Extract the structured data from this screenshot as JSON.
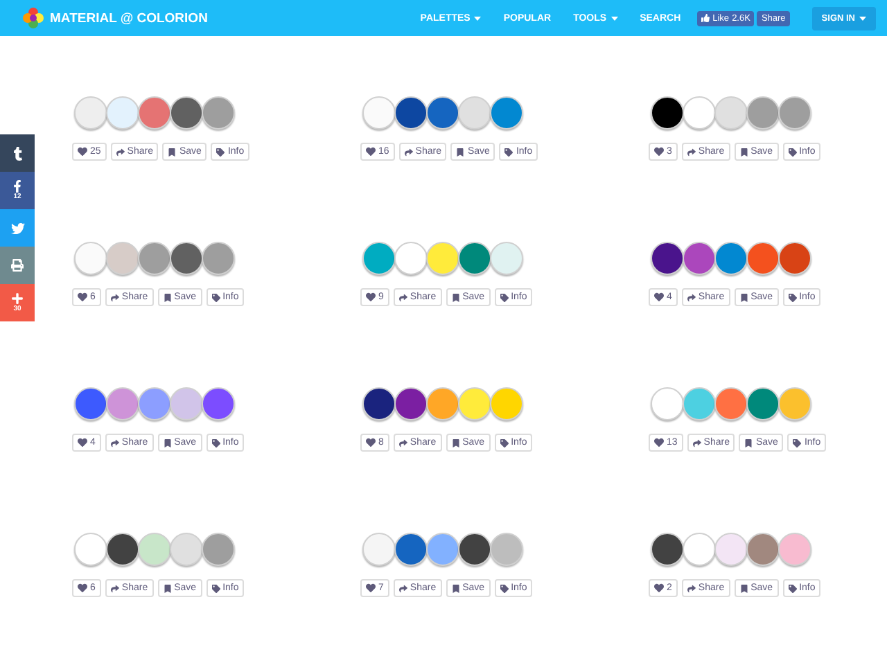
{
  "header": {
    "logo": "MATERIAL @ COLORION",
    "nav": [
      {
        "label": "PALETTES",
        "kind": "dropdown"
      },
      {
        "label": "POPULAR",
        "kind": "link"
      },
      {
        "label": "TOOLS",
        "kind": "dropdown"
      },
      {
        "label": "SEARCH",
        "kind": "link"
      }
    ],
    "like": {
      "label": "Like",
      "count": "2.6K"
    },
    "share": "Share",
    "sign_in": "SIGN IN"
  },
  "share_bar": [
    {
      "kind": "tumblr"
    },
    {
      "kind": "facebook",
      "count": "12"
    },
    {
      "kind": "twitter"
    },
    {
      "kind": "print"
    },
    {
      "kind": "add",
      "count": "30"
    }
  ],
  "palettes": [
    {
      "swatches": [
        {
          "color": "#eeeeee"
        },
        {
          "color": "#e3f2fd"
        },
        {
          "color": "#e57373"
        },
        {
          "color": "#616161"
        },
        {
          "color": "#9e9e9e"
        }
      ],
      "likes": "25",
      "actions": [
        "Share",
        "Save",
        "Info"
      ]
    },
    {
      "swatches": [
        {
          "color": "#fafafa"
        },
        {
          "color": "#0d47a1"
        },
        {
          "color": "#1565c0"
        },
        {
          "color": "#e0e0e0"
        },
        {
          "color": "#0288d1"
        }
      ],
      "likes": "16",
      "actions": [
        "Share",
        "Save",
        "Info"
      ]
    },
    {
      "swatches": [
        {
          "color": "#000000"
        },
        {
          "color": "#ffffff"
        },
        {
          "color": "#e0e0e0"
        },
        {
          "color": "#9e9e9e"
        },
        {
          "color": "#9e9e9e"
        }
      ],
      "likes": "3",
      "actions": [
        "Share",
        "Save",
        "Info"
      ]
    },
    {
      "swatches": [
        {
          "color": "#fafafa"
        },
        {
          "color": "#d7ccc8"
        },
        {
          "color": "#9e9e9e"
        },
        {
          "color": "#616161"
        },
        {
          "color": "#9e9e9e"
        }
      ],
      "likes": "6",
      "actions": [
        "Share",
        "Save",
        "Info"
      ]
    },
    {
      "swatches": [
        {
          "color": "#00acc1"
        },
        {
          "color": "#ffffff"
        },
        {
          "color": "#ffeb3b"
        },
        {
          "color": "#00897b"
        },
        {
          "color": "#e0f2f1"
        }
      ],
      "likes": "9",
      "actions": [
        "Share",
        "Save",
        "Info"
      ]
    },
    {
      "swatches": [
        {
          "color": "#4a148c"
        },
        {
          "color": "#ab47bc"
        },
        {
          "color": "#0288d1"
        },
        {
          "color": "#f4511e"
        },
        {
          "color": "#d84315"
        }
      ],
      "likes": "4",
      "actions": [
        "Share",
        "Save",
        "Info"
      ]
    },
    {
      "swatches": [
        {
          "color": "#3d5afe"
        },
        {
          "color": "#ce93d8"
        },
        {
          "color": "#8c9eff"
        },
        {
          "color": "#d1c4e9"
        },
        {
          "color": "#7c4dff"
        }
      ],
      "likes": "4",
      "actions": [
        "Share",
        "Save",
        "Info"
      ]
    },
    {
      "swatches": [
        {
          "color": "#1a237e"
        },
        {
          "color": "#7b1fa2"
        },
        {
          "color": "#ffa726"
        },
        {
          "color": "#ffeb3b"
        },
        {
          "color": "#ffd600"
        }
      ],
      "likes": "8",
      "actions": [
        "Share",
        "Save",
        "Info"
      ]
    },
    {
      "swatches": [
        {
          "color": "#ffffff"
        },
        {
          "color": "#4dd0e1"
        },
        {
          "color": "#ff7043"
        },
        {
          "color": "#00897b"
        },
        {
          "color": "#fbc02d"
        }
      ],
      "likes": "13",
      "actions": [
        "Share",
        "Save",
        "Info"
      ]
    },
    {
      "swatches": [
        {
          "color": "#ffffff"
        },
        {
          "color": "#424242"
        },
        {
          "color": "#c8e6c9"
        },
        {
          "color": "#e0e0e0"
        },
        {
          "color": "#9e9e9e"
        }
      ],
      "likes": "6",
      "actions": [
        "Share",
        "Save",
        "Info"
      ]
    },
    {
      "swatches": [
        {
          "color": "#f5f5f5"
        },
        {
          "color": "#1565c0"
        },
        {
          "color": "#82b1ff"
        },
        {
          "color": "#424242"
        },
        {
          "color": "#bdbdbd"
        }
      ],
      "likes": "7",
      "actions": [
        "Share",
        "Save",
        "Info"
      ]
    },
    {
      "swatches": [
        {
          "color": "#424242"
        },
        {
          "color": "#ffffff"
        },
        {
          "color": "#f3e5f5"
        },
        {
          "color": "#a1887f"
        },
        {
          "color": "#f8bbd0"
        }
      ],
      "likes": "2",
      "actions": [
        "Share",
        "Save",
        "Info"
      ]
    }
  ]
}
